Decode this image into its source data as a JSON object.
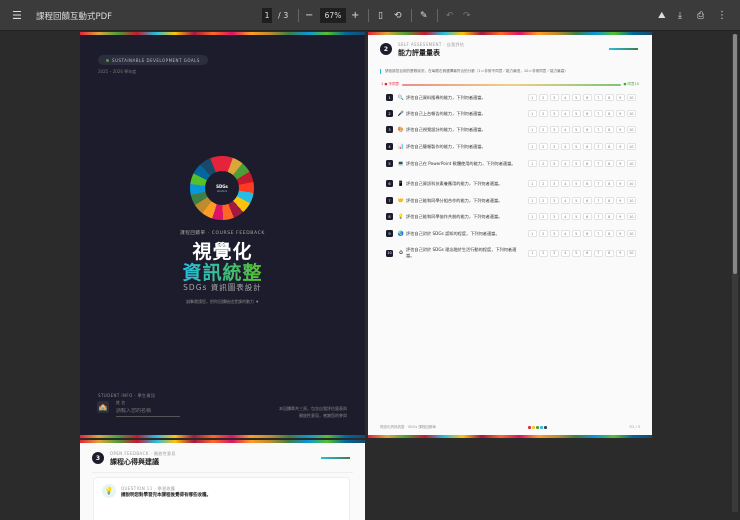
{
  "toolbar": {
    "title": "課程回饋互動式PDF",
    "page_current": "1",
    "page_total": "/ 3",
    "zoom": "67%",
    "minus": "−",
    "plus": "+"
  },
  "cover": {
    "chip": "SUSTAINABLE DEVELOPMENT GOALS",
    "year": "2025 – 2026 學年度",
    "wheel_title": "SDGs",
    "wheel_sub": "GOALS",
    "kicker": "課程回饋單 · COURSE FEEDBACK",
    "title1": "視覺化",
    "title2": "資訊統整",
    "subtitle": "SDGs 資訊圖表設計",
    "tagline": "誠摯邀請您，把你回饋給這堂課的動力 ♦",
    "student_label": "STUDENT INFO · 學生資訊",
    "name_label": "姓 名",
    "name_placeholder": "請輸入您的名稱",
    "note1": "本回饋單共三頁，包含自我評估量表與",
    "note2": "開放性意見，感謝您的參與"
  },
  "assessment": {
    "number": "2",
    "eyebrow": "SELF ASSESSMENT · 自我評估",
    "title": "能力評量量表",
    "instruction": "請依據您目前的實際狀況，在每題右側選擇最符合的分數（1＝非常不同意／能力最低，10＝非常同意／能力最高）",
    "scale_low": "1 ● 不同意",
    "scale_high": "● 同意10",
    "options": [
      "1",
      "2",
      "3",
      "4",
      "5",
      "6",
      "7",
      "8",
      "9",
      "10"
    ],
    "items": [
      {
        "n": "1",
        "icon": "🔍",
        "text": "評估自己資料搜尋的能力，下列何者適當。"
      },
      {
        "n": "2",
        "icon": "🎤",
        "text": "評估自己上台報告的能力，下列何者適當。"
      },
      {
        "n": "3",
        "icon": "🎨",
        "text": "評估自己視覺設計的能力，下列何者適當。"
      },
      {
        "n": "4",
        "icon": "📊",
        "text": "評估自己簡報製作的能力，下列何者適當。"
      },
      {
        "n": "5",
        "icon": "💻",
        "text": "評估自己在 PowerPoint 軟體使用的能力，下列何者適當。"
      },
      {
        "n": "6",
        "icon": "📱",
        "text": "評估自己資訊科技素養應用的能力，下列何者適當。"
      },
      {
        "n": "7",
        "icon": "🤝",
        "text": "評估自己能和同學分組合作的能力，下列何者適當。"
      },
      {
        "n": "8",
        "icon": "💡",
        "text": "評估自己能和同學協作共創的能力，下列何者適當。"
      },
      {
        "n": "9",
        "icon": "🌏",
        "text": "評估自己對於 SDGs 認知的程度，下列何者適當。"
      },
      {
        "n": "10",
        "icon": "♻",
        "text": "評估自己對於 SDGs 理念融於生活行動的程度，下列何者適當。"
      }
    ],
    "footer_left": "視覺化資訊統整 · SDGs 課程回饋單",
    "footer_right": "P.2 / 3",
    "dot_colors": [
      "#e5243b",
      "#fcc30b",
      "#4c9f38",
      "#26bde2",
      "#19486a"
    ]
  },
  "feedback": {
    "number": "3",
    "eyebrow": "OPEN FEEDBACK · 開放性意見",
    "title": "課程心得與建議",
    "q_eyebrow": "QUESTION 11 · 學習收穫",
    "question": "請說明您對學習完本課程後覺得有哪些收穫。"
  }
}
